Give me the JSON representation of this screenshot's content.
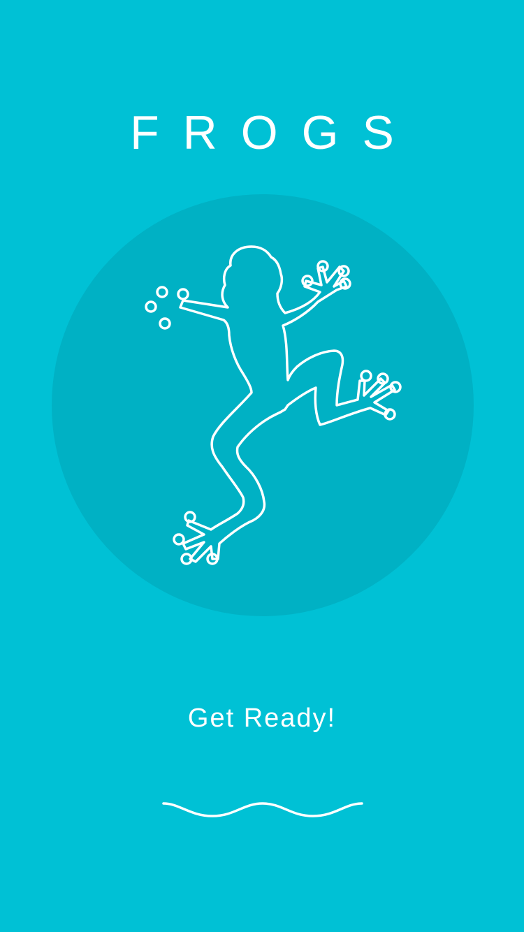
{
  "app": {
    "title": "FROGS"
  },
  "hero": {
    "icon": "frog-icon"
  },
  "status": {
    "message": "Get Ready!"
  },
  "decoration": {
    "icon": "wave-icon"
  },
  "colors": {
    "background": "#00c1d5",
    "circle": "#00b1c4",
    "foreground": "#ffffff"
  }
}
